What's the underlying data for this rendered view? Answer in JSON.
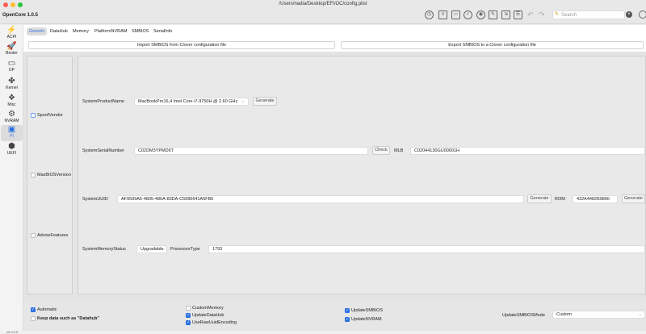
{
  "window": {
    "title": "/Users/nadia/Desktop/EFI/OC/config.plist",
    "app_name": "OpenCore 1.0.5"
  },
  "toolbar": {
    "search_placeholder": "Search",
    "undo": "↶",
    "redo": "↷"
  },
  "sidebar": {
    "items": [
      {
        "label": "ACPI",
        "icon": "⚡"
      },
      {
        "label": "Booter",
        "icon": "🚀"
      },
      {
        "label": "DP",
        "icon": "▭"
      },
      {
        "label": "Kernel",
        "icon": "✤"
      },
      {
        "label": "Misc",
        "icon": "❖"
      },
      {
        "label": "NVRAM",
        "icon": "⚙"
      },
      {
        "label": "PI",
        "icon": "▣"
      },
      {
        "label": "UEFI",
        "icon": "⬢"
      }
    ]
  },
  "tabs": [
    "Generic",
    "DataHub",
    "Memory",
    "PlatformNVRAM",
    "SMBIOS",
    "SerialInfo"
  ],
  "actions": {
    "import": "Import SMBIOS from Clover configuration file",
    "export": "Export SMBIOS to a Clover configuration file"
  },
  "left_options": [
    {
      "label": "SpoofVendor",
      "checked": false
    },
    {
      "label": "MaxBIOSVersion",
      "checked": false
    },
    {
      "label": "AdviseFeatures",
      "checked": false
    }
  ],
  "fields": {
    "product_label": "SystemProductName",
    "product_value": "MacBookPro16,4     Intel Core i7-9750H @ 2.60 GHz",
    "generate": "Generate",
    "serial_label": "SystemSerialNumber",
    "serial_value": "C02DM3YPMD6T",
    "check": "Check",
    "mlb_label": "MLB",
    "mlb_value": "C02044130GU00001H",
    "uuid_label": "SystemUUID",
    "uuid_value": "AF9599A5-4805-480A-83DA-C5086641A5FB6",
    "rom_label": "ROM",
    "rom_value": "432A4482B9866",
    "memory_label": "SystemMemoryStatus",
    "memory_value": "Upgradable",
    "processor_label": "ProcessorType",
    "processor_value": "1793"
  },
  "bottom": {
    "automatic": "Automatic",
    "keep_data": "Keep data such as \"Datahub\"",
    "custom_memory": "CustomMemory",
    "update_datahub": "UpdateDataHub",
    "use_raw_uuid": "UseRawUuidEncoding",
    "update_smbios": "UpdateSMBIOS",
    "update_nvram": "UpdateNVRAM",
    "mode_label": "UpdateSMBIOSMode",
    "mode_value": "Custom"
  },
  "status": "v0.0.0.0"
}
